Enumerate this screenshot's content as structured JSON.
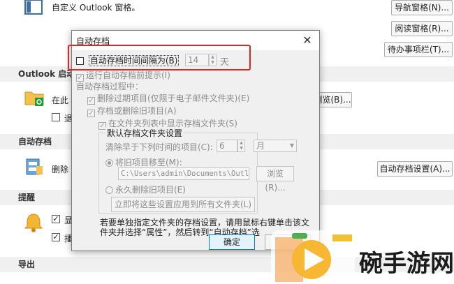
{
  "background": {
    "top_desc": "自定义 Outlook 窗格。",
    "btn_nav": "导航窗格(N)...",
    "btn_read": "阅读窗格(R)...",
    "btn_todo": "待办事项栏(T)...",
    "sec_start": "Outlook 启动",
    "start_text": "在此",
    "start_sub": "退",
    "start_btn": "浏览(B)...",
    "sec_autoarchive": "自动存档",
    "autoarchive_text": "删除",
    "autoarchive_btn": "自动存档设置(A)...",
    "sec_reminder": "提醒",
    "reminder_1": "显",
    "reminder_2": "播",
    "sec_export": "导出"
  },
  "dialog": {
    "title": "自动存档",
    "close_glyph": "✕",
    "auto_every": "自动存档时间间隔为(B)",
    "days_value": "14",
    "days_unit": "天",
    "prompt_before": "运行自动存档前提示(I)",
    "during": "自动存档过程中：",
    "delete_expired": "删除过期项目(仅限于电子邮件文件夹)(E)",
    "archive_or_delete": "存档或删除旧项目(A)",
    "show_in_list": "在文件夹列表中显示存档文件夹(S)",
    "group_title": "默认存档文件夹设置",
    "clean_older": "清除早于下列时间的项目(C):",
    "months_value": "6",
    "months_unit": "月",
    "move_to": "将旧项目移至(M):",
    "path": "C:\\Users\\admin\\Documents\\Outlook",
    "browse": "浏览(R)...",
    "perm_delete": "永久删除旧项目(E)",
    "apply_all": "立即将这些设置应用到所有文件夹(L)",
    "note_1": "若要单独指定文件夹的存档设置，请用鼠标右键单击该文",
    "note_2": "件夹并选择“属性”，然后转到“自动存档”选",
    "ok": "确定",
    "checkmark": "✓"
  },
  "watermark": {
    "text": "碗手游网"
  }
}
